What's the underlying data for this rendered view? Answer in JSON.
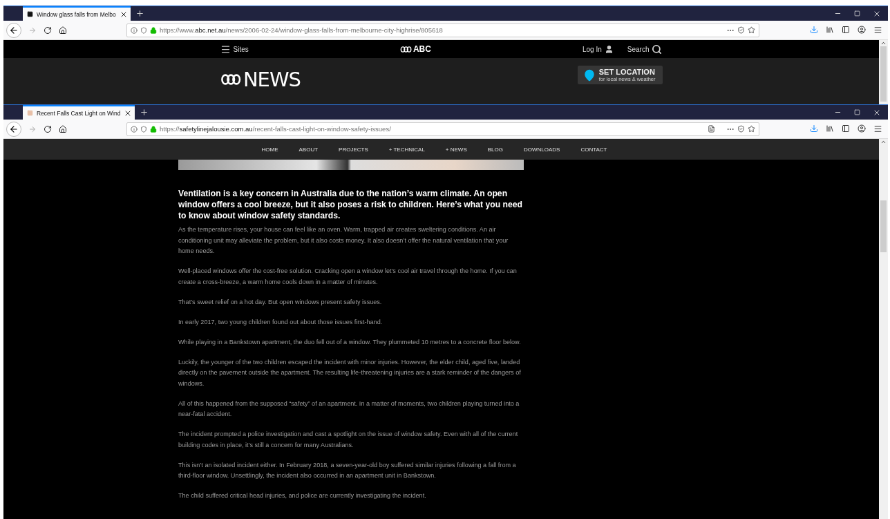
{
  "back_window": {
    "tabs": [
      {
        "title": "Window glass falls from Melbo",
        "selected": true
      }
    ],
    "url": {
      "scheme": "https://www.",
      "domain": "abc.net.au",
      "path": "/news/2006-02-24/window-glass-falls-from-melbourne-city-highrise/805618"
    },
    "site": {
      "sites_label": "Sites",
      "brand": "ABC",
      "login": "Log In",
      "search": "Search",
      "news_logo": "NEWS",
      "location": {
        "title": "SET LOCATION",
        "subtitle": "for local news & weather"
      }
    }
  },
  "front_window": {
    "tabs": [
      {
        "title": "Recent Falls Cast Light on Wind",
        "selected": true
      }
    ],
    "url": {
      "scheme": "https://",
      "domain": "safetylinejalousie.com.au",
      "path": "/recent-falls-cast-light-on-window-safety-issues/"
    },
    "nav": [
      "HOME",
      "ABOUT",
      "PROJECTS",
      "+ TECHNICAL",
      "+ NEWS",
      "BLOG",
      "DOWNLOADS",
      "CONTACT"
    ],
    "article": {
      "lead": "Ventilation is a key concern in Australia due to the nation’s warm climate. An open window offers a cool breeze, but it also poses a risk to children. Here’s what you need to know about window safety standards.",
      "paragraphs": [
        "As the temperature rises, your house can feel like an oven. Warm, trapped air creates sweltering conditions. An air conditioning unit may alleviate the problem, but it also costs money. It also doesn’t offer the natural ventilation that your home needs.",
        "Well-placed windows offer the cost-free solution. Cracking open a window let’s cool air travel through the home. If you can create a cross-breeze, a warm home cools down in a matter of minutes.",
        "That’s sweet relief on a hot day. But open windows present safety issues.",
        "In early 2017, two young children found out about those issues first-hand.",
        "While playing in a Bankstown apartment, the duo fell out of a window. They plummeted 10 metres to a concrete floor below.",
        "Luckily, the younger of the two children escaped the incident with minor injuries. However, the elder child, aged five, landed directly on the pavement outside the apartment. The resulting life-threatening injuries are a stark reminder of the dangers of windows.",
        "All of this happened from the supposed “safety” of an apartment. In a matter of moments, two children playing turned into a near-fatal accident.",
        "The incident prompted a police investigation and cast a spotlight on the issue of window safety. Even with all of the current building codes in place, it’s still a concern for many Australians.",
        "This isn’t an isolated incident either. In February 2018, a seven-year-old boy suffered similar injuries following a fall from a third-floor window. Unsettlingly, the incident also occurred in an apartment unit in Bankstown.",
        "The child suffered critical head injuries, and police are currently investigating the incident."
      ]
    }
  }
}
